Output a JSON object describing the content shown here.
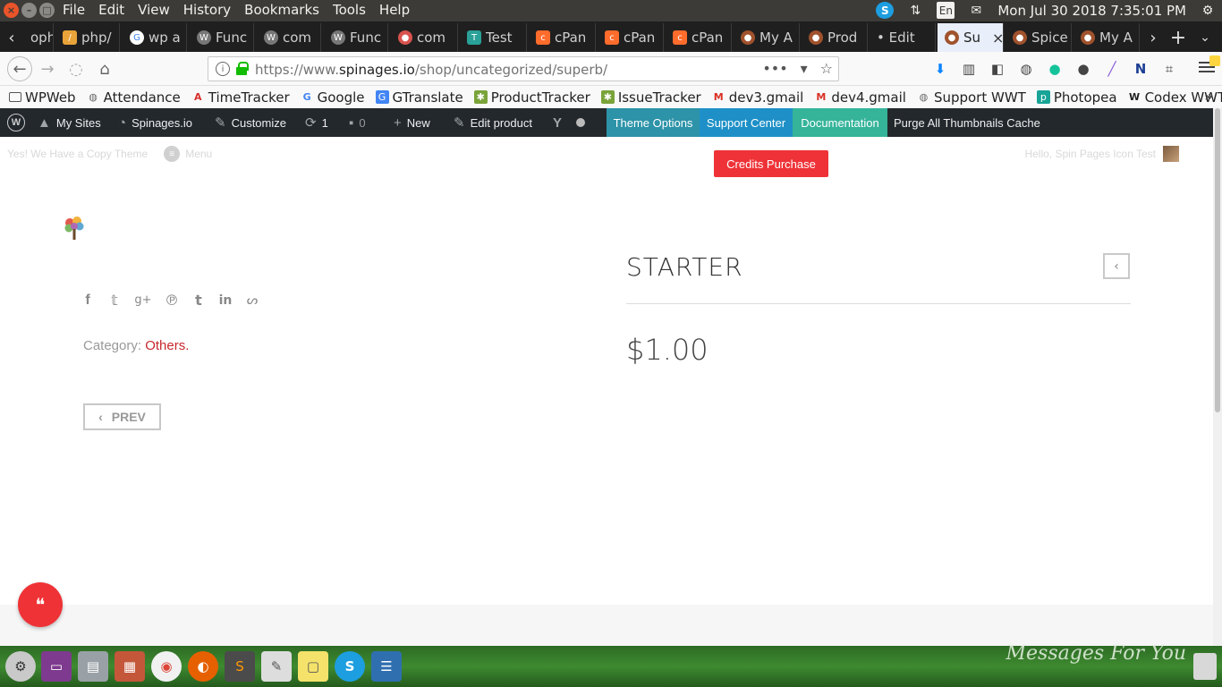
{
  "os": {
    "menu": [
      "File",
      "Edit",
      "View",
      "History",
      "Bookmarks",
      "Tools",
      "Help"
    ],
    "lang": "En",
    "clock": "Mon Jul 30 2018 7:35:01 PM"
  },
  "tabs": [
    {
      "label": "oph",
      "color": "#666666"
    },
    {
      "label": "php/",
      "color": "#e8a33a"
    },
    {
      "label": "wp a",
      "color": "#4285f4"
    },
    {
      "label": "Func",
      "color": "#666666"
    },
    {
      "label": "com",
      "color": "#666666"
    },
    {
      "label": "Func",
      "color": "#666666"
    },
    {
      "label": "com",
      "color": "#d9534f"
    },
    {
      "label": "Test",
      "color": "#2aa198"
    },
    {
      "label": "cPan",
      "color": "#ff6c2c"
    },
    {
      "label": "cPan",
      "color": "#ff6c2c"
    },
    {
      "label": "cPan",
      "color": "#ff6c2c"
    },
    {
      "label": "My A",
      "color": "#a0522d"
    },
    {
      "label": "Prod",
      "color": "#a0522d"
    },
    {
      "label": "• Edit",
      "color": "#1f1f1f"
    },
    {
      "label": "Su",
      "color": "#a0522d"
    },
    {
      "label": "Spice",
      "color": "#a0522d"
    },
    {
      "label": "My A",
      "color": "#a0522d"
    }
  ],
  "url": {
    "prefix": "https://www.",
    "domain": "spinages.io",
    "path": "/shop/uncategorized/superb/"
  },
  "bookmarks": [
    {
      "label": "WPWeb",
      "icon": "folder-icon"
    },
    {
      "label": "Attendance",
      "icon": "globe-icon"
    },
    {
      "label": "TimeTracker",
      "icon": "acrobat-icon"
    },
    {
      "label": "Google",
      "icon": "google-icon"
    },
    {
      "label": "GTranslate",
      "icon": "translate-icon"
    },
    {
      "label": "ProductTracker",
      "icon": "bug-icon"
    },
    {
      "label": "IssueTracker",
      "icon": "bug-icon"
    },
    {
      "label": "dev3.gmail",
      "icon": "gmail-icon"
    },
    {
      "label": "dev4.gmail",
      "icon": "gmail-icon"
    },
    {
      "label": "Support WWT",
      "icon": "globe-icon"
    },
    {
      "label": "Photopea",
      "icon": "photopea-icon"
    },
    {
      "label": "Codex WWT",
      "icon": "wordpress-icon"
    }
  ],
  "wpbar": {
    "my_sites": "My Sites",
    "site": "Spinages.io",
    "customize": "Customize",
    "updates": "1",
    "comments": "0",
    "new": "New",
    "edit_product": "Edit product",
    "theme_options": "Theme Options",
    "support_center": "Support Center",
    "documentation": "Documentation",
    "purge": "Purge All Thumbnails Cache",
    "colors": {
      "theme_options": "#2d93a8",
      "support_center": "#1e90c7",
      "documentation": "#35b49a"
    }
  },
  "page": {
    "topinfo_left": "Yes! We Have a Copy Theme",
    "menu_label": "Menu",
    "credits_button": "Credits Purchase",
    "topinfo_right": "Hello, Spin Pages Icon Test",
    "category_label": "Category:",
    "category_value": "Others.",
    "prev_label": "PREV",
    "product_title": "STARTER",
    "price": "$1.00",
    "accent_color": "#ee3237"
  },
  "dock": {
    "wallpaper_text": "Messages For You"
  }
}
